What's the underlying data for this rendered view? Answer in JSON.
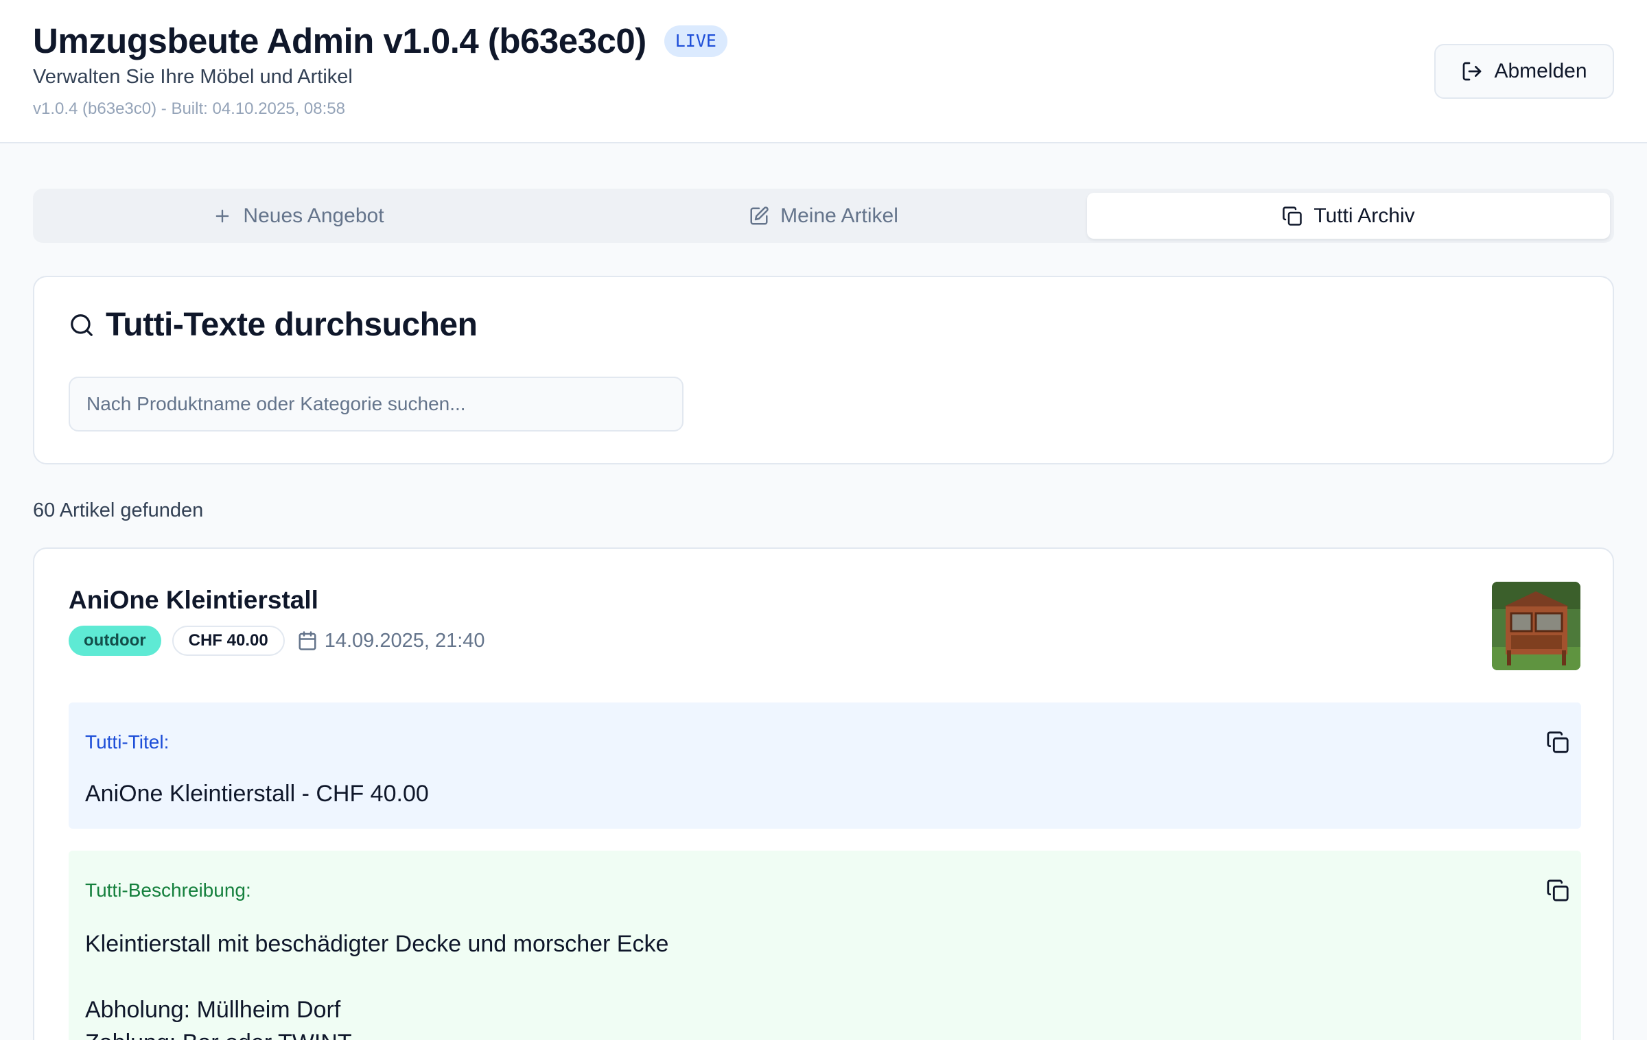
{
  "header": {
    "title": "Umzugsbeute Admin v1.0.4 (b63e3c0)",
    "live_badge": "LIVE",
    "subtitle": "Verwalten Sie Ihre Möbel und Artikel",
    "build_info": "v1.0.4 (b63e3c0) - Built: 04.10.2025, 08:58",
    "logout_label": "Abmelden",
    "logout_icon": "logout-icon"
  },
  "tabs": [
    {
      "label": "Neues Angebot",
      "icon": "plus-icon",
      "active": false
    },
    {
      "label": "Meine Artikel",
      "icon": "edit-icon",
      "active": false
    },
    {
      "label": "Tutti Archiv",
      "icon": "copy-icon",
      "active": true
    }
  ],
  "search": {
    "heading": "Tutti-Texte durchsuchen",
    "icon": "search-icon",
    "placeholder": "Nach Produktname oder Kategorie suchen...",
    "value": ""
  },
  "results": {
    "count_text": "60 Artikel gefunden"
  },
  "articles": [
    {
      "title": "AniOne Kleintierstall",
      "category": "outdoor",
      "price": "CHF 40.00",
      "date": "14.09.2025, 21:40",
      "tutti_title_label": "Tutti-Titel:",
      "tutti_title": "AniOne Kleintierstall - CHF 40.00",
      "tutti_desc_label": "Tutti-Beschreibung:",
      "tutti_desc_lines": [
        "Kleintierstall mit beschädigter Decke und morscher Ecke",
        "",
        "Abholung: Müllheim Dorf",
        "Zahlung: Bar oder TWINT"
      ]
    }
  ],
  "colors": {
    "accent": "#1d4ed8",
    "category_badge": "#5eead4",
    "title_box_bg": "#eff6ff",
    "desc_box_bg": "#f0fdf4"
  }
}
